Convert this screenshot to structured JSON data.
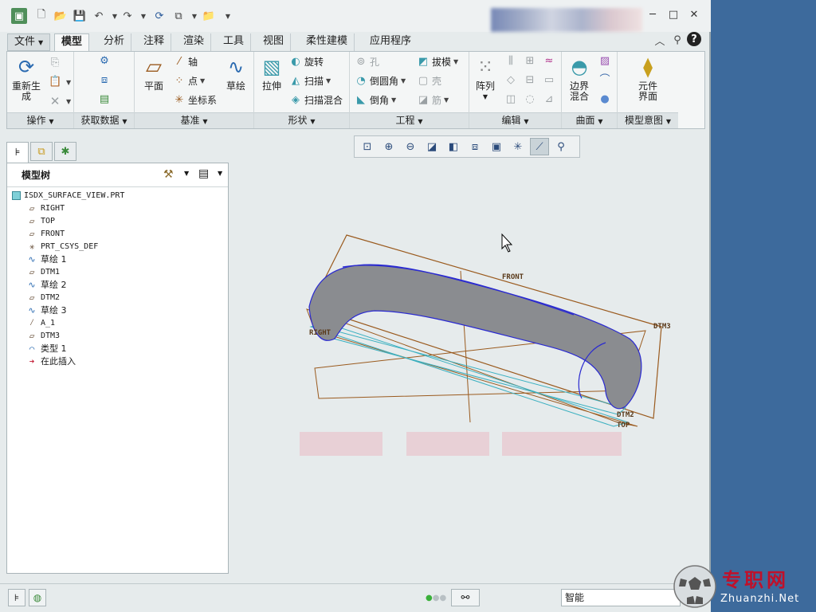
{
  "titlebar": {
    "icons": [
      "app-icon",
      "new-icon",
      "open-icon",
      "save-icon",
      "undo-icon",
      "redo-icon",
      "regenerate-icon",
      "windows-icon",
      "folder-icon",
      "customize-icon"
    ],
    "minimize": "─",
    "maximize": "□",
    "close": "✕"
  },
  "tabs": {
    "file": "文件",
    "items": [
      "模型",
      "分析",
      "注释",
      "渲染",
      "工具",
      "视图",
      "柔性建模",
      "应用程序"
    ]
  },
  "ribbon": {
    "groups": {
      "operations": "操作",
      "get_data": "获取数据",
      "datum": "基准",
      "shapes": "形状",
      "engineering": "工程",
      "editing": "编辑",
      "surfaces": "曲面",
      "model_intent": "模型意图"
    },
    "regenerate": "重新生成",
    "plane": "平面",
    "axis": "轴",
    "point": "点",
    "csys": "坐标系",
    "sketch": "草绘",
    "extrude": "拉伸",
    "revolve": "旋转",
    "sweep": "扫描",
    "swept_blend": "扫描混合",
    "hole": "孔",
    "round": "倒圆角",
    "chamfer": "倒角",
    "draft": "拔模",
    "shell": "壳",
    "rib": "筋",
    "pattern": "阵列",
    "boundary_blend": "边界混合",
    "component_interface": "元件界面"
  },
  "tree": {
    "title": "模型树",
    "items": [
      {
        "label": "ISDX_SURFACE_VIEW.PRT",
        "icon": "part-icon"
      },
      {
        "label": "RIGHT",
        "icon": "datum-plane-icon"
      },
      {
        "label": "TOP",
        "icon": "datum-plane-icon"
      },
      {
        "label": "FRONT",
        "icon": "datum-plane-icon"
      },
      {
        "label": "PRT_CSYS_DEF",
        "icon": "csys-icon"
      },
      {
        "label": "草绘 1",
        "icon": "sketch-icon"
      },
      {
        "label": "DTM1",
        "icon": "datum-plane-icon"
      },
      {
        "label": "草绘 2",
        "icon": "sketch-icon"
      },
      {
        "label": "DTM2",
        "icon": "datum-plane-icon"
      },
      {
        "label": "草绘 3",
        "icon": "sketch-icon"
      },
      {
        "label": "A_1",
        "icon": "axis-icon"
      },
      {
        "label": "DTM3",
        "icon": "datum-plane-icon"
      },
      {
        "label": "类型 1",
        "icon": "style-icon"
      },
      {
        "label": "在此插入",
        "icon": "insert-here-icon"
      }
    ]
  },
  "viewport": {
    "labels": {
      "front": "FRONT",
      "right": "RIGHT",
      "dtm3": "DTM3",
      "dtm2": "DTM2",
      "top": "TOP"
    }
  },
  "status": {
    "filter": "智能"
  },
  "watermark": {
    "cn": "专职网",
    "en": "Zhuanzhi.Net"
  },
  "colors": {
    "accent": "#3d6a9c",
    "datum_plane": "#9a5a1e",
    "surface_edge": "#2a2ad0",
    "surface_fill": "#8a8c90",
    "watermark_red": "#c0102a"
  }
}
